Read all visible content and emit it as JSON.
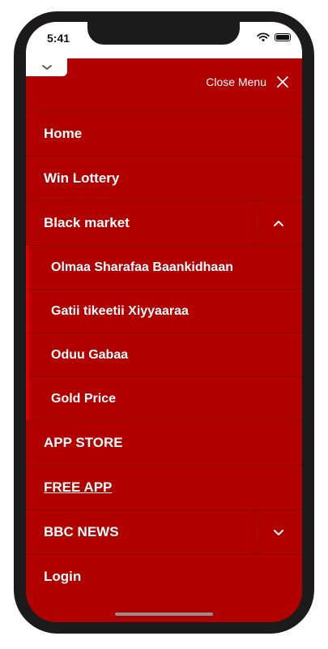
{
  "status_bar": {
    "time": "5:41"
  },
  "header": {
    "close_label": "Close Menu"
  },
  "menu": {
    "home": "Home",
    "win_lottery": "Win Lottery",
    "black_market": "Black market",
    "black_market_sub": [
      "Olmaa Sharafaa Baankidhaan",
      "Gatii tikeetii Xiyyaaraa",
      "Oduu Gabaa",
      "Gold Price"
    ],
    "app_store": "APP STORE",
    "free_app": "FREE APP",
    "bbc_news": "BBC NEWS",
    "login": "Login"
  },
  "colors": {
    "menu_bg": "#b10000",
    "accent_bar": "#e10000",
    "text": "#ffffff"
  },
  "icons": {
    "collapse": "chevron-down-icon",
    "close": "close-icon",
    "black_market_toggle": "chevron-up-icon",
    "bbc_news_toggle": "chevron-down-icon"
  }
}
